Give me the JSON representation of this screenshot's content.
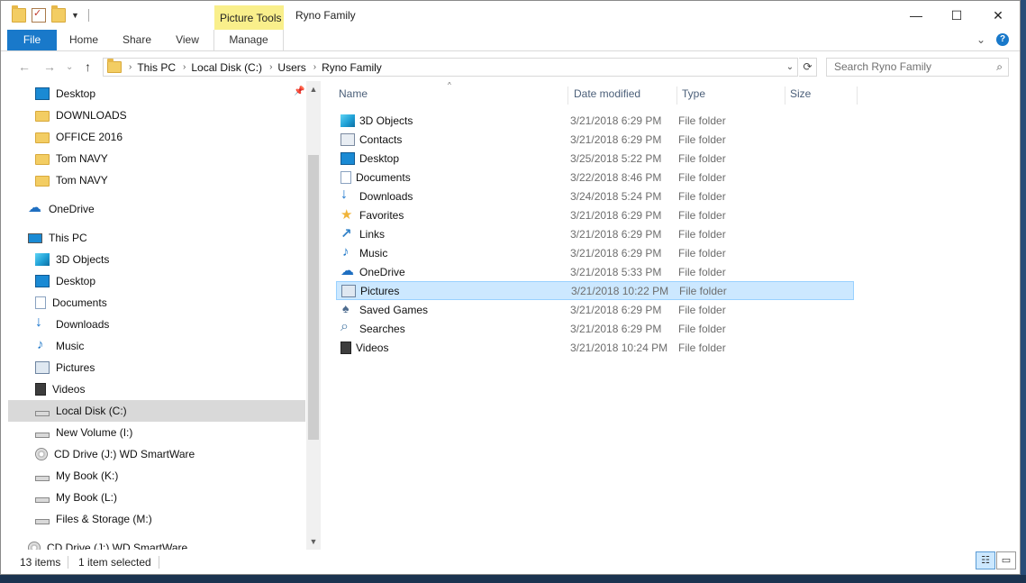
{
  "window": {
    "title": "Ryno Family",
    "context_tab": "Picture Tools",
    "controls": {
      "minimize": "—",
      "maximize": "☐",
      "close": "✕"
    }
  },
  "ribbon": {
    "tabs": [
      "File",
      "Home",
      "Share",
      "View",
      "Manage"
    ],
    "expand_icon": "⌄",
    "help_icon": "?"
  },
  "address": {
    "back": "←",
    "forward": "→",
    "recent": "⌄",
    "up": "↑",
    "crumbs": [
      "This PC",
      "Local Disk (C:)",
      "Users",
      "Ryno Family"
    ],
    "chevron": "›",
    "dropdown": "⌄",
    "refresh": "⟳",
    "search_placeholder": "Search Ryno Family",
    "search_icon": "⌕"
  },
  "nav": {
    "pin": "📌",
    "scroll_up": "▲",
    "scroll_down": "▼",
    "items": [
      {
        "label": "Desktop",
        "icon": "desktop-icon"
      },
      {
        "label": "DOWNLOADS",
        "icon": "folder-icon"
      },
      {
        "label": "OFFICE 2016",
        "icon": "folder-icon"
      },
      {
        "label": "Tom NAVY",
        "icon": "folder-icon"
      },
      {
        "label": "Tom NAVY",
        "icon": "folder-icon"
      },
      {
        "label": "OneDrive",
        "icon": "onedrive-icon"
      },
      {
        "label": "This PC",
        "icon": "pc-icon"
      },
      {
        "label": "3D Objects",
        "icon": "3d-objects-icon"
      },
      {
        "label": "Desktop",
        "icon": "desktop-icon"
      },
      {
        "label": "Documents",
        "icon": "documents-icon"
      },
      {
        "label": "Downloads",
        "icon": "downloads-icon"
      },
      {
        "label": "Music",
        "icon": "music-icon"
      },
      {
        "label": "Pictures",
        "icon": "pictures-icon"
      },
      {
        "label": "Videos",
        "icon": "videos-icon"
      },
      {
        "label": "Local Disk (C:)",
        "icon": "local-disk-icon",
        "selected": true
      },
      {
        "label": "New Volume (I:)",
        "icon": "drive-icon"
      },
      {
        "label": "CD Drive (J:) WD SmartWare",
        "icon": "cd-drive-icon"
      },
      {
        "label": "My Book (K:)",
        "icon": "drive-icon"
      },
      {
        "label": "My Book (L:)",
        "icon": "drive-icon"
      },
      {
        "label": "Files & Storage (M:)",
        "icon": "drive-icon"
      },
      {
        "label": "CD Drive (J:) WD SmartWare",
        "icon": "cd-drive-icon"
      }
    ]
  },
  "columns": {
    "name": "Name",
    "date": "Date modified",
    "type": "Type",
    "size": "Size",
    "sort_icon": "^"
  },
  "files": [
    {
      "name": "3D Objects",
      "date": "3/21/2018 6:29 PM",
      "type": "File folder",
      "icon": "3d-objects-icon"
    },
    {
      "name": "Contacts",
      "date": "3/21/2018 6:29 PM",
      "type": "File folder",
      "icon": "contacts-icon"
    },
    {
      "name": "Desktop",
      "date": "3/25/2018 5:22 PM",
      "type": "File folder",
      "icon": "desktop-icon"
    },
    {
      "name": "Documents",
      "date": "3/22/2018 8:46 PM",
      "type": "File folder",
      "icon": "documents-icon"
    },
    {
      "name": "Downloads",
      "date": "3/24/2018 5:24 PM",
      "type": "File folder",
      "icon": "downloads-icon"
    },
    {
      "name": "Favorites",
      "date": "3/21/2018 6:29 PM",
      "type": "File folder",
      "icon": "favorites-icon"
    },
    {
      "name": "Links",
      "date": "3/21/2018 6:29 PM",
      "type": "File folder",
      "icon": "links-icon"
    },
    {
      "name": "Music",
      "date": "3/21/2018 6:29 PM",
      "type": "File folder",
      "icon": "music-icon"
    },
    {
      "name": "OneDrive",
      "date": "3/21/2018 5:33 PM",
      "type": "File folder",
      "icon": "onedrive-icon"
    },
    {
      "name": "Pictures",
      "date": "3/21/2018 10:22 PM",
      "type": "File folder",
      "icon": "pictures-icon",
      "selected": true
    },
    {
      "name": "Saved Games",
      "date": "3/21/2018 6:29 PM",
      "type": "File folder",
      "icon": "saved-games-icon"
    },
    {
      "name": "Searches",
      "date": "3/21/2018 6:29 PM",
      "type": "File folder",
      "icon": "searches-icon"
    },
    {
      "name": "Videos",
      "date": "3/21/2018 10:24 PM",
      "type": "File folder",
      "icon": "videos-icon"
    }
  ],
  "status": {
    "items": "13 items",
    "selected": "1 item selected",
    "details_view": "☷",
    "tiles_view": "▭"
  },
  "colors": {
    "accent": "#1979CA",
    "selection": "#CCE8FF",
    "context_tab": "#F9EF8B"
  }
}
